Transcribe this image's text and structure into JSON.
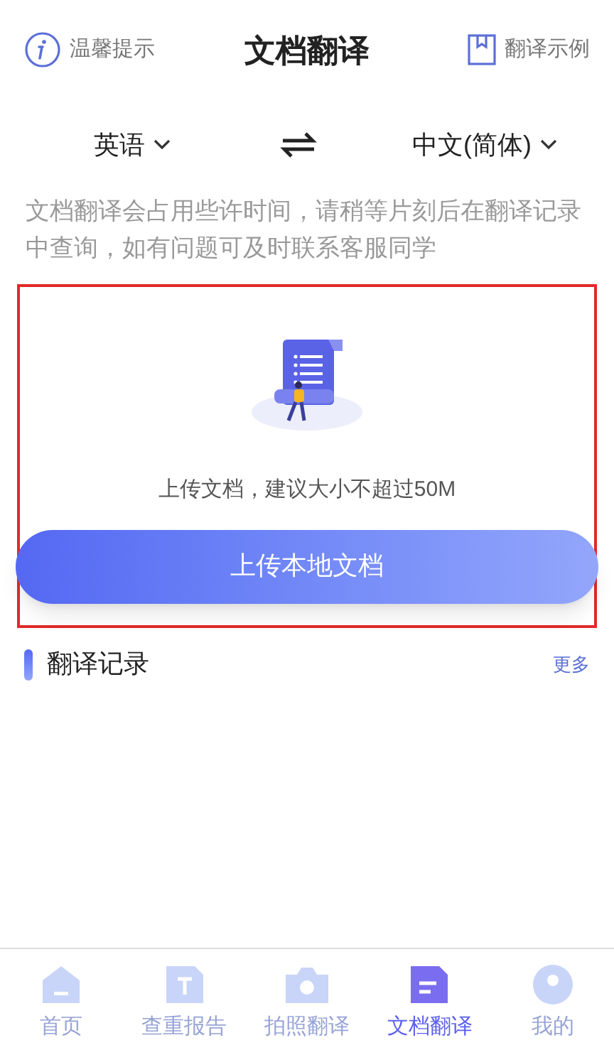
{
  "header": {
    "tip": "温馨提示",
    "title": "文档翻译",
    "example": "翻译示例"
  },
  "languages": {
    "source": "英语",
    "target": "中文(简体)"
  },
  "notice": "文档翻译会占用些许时间，请稍等片刻后在翻译记录中查询，如有问题可及时联系客服同学",
  "upload": {
    "hint": "上传文档，建议大小不超过50M",
    "button": "上传本地文档"
  },
  "records": {
    "title": "翻译记录",
    "more": "更多"
  },
  "tabs": [
    {
      "label": "首页",
      "kind": "home",
      "selected": false
    },
    {
      "label": "查重报告",
      "kind": "report",
      "selected": false
    },
    {
      "label": "拍照翻译",
      "kind": "camera",
      "selected": false
    },
    {
      "label": "文档翻译",
      "kind": "doc",
      "selected": true
    },
    {
      "label": "我的",
      "kind": "me",
      "selected": false
    }
  ]
}
